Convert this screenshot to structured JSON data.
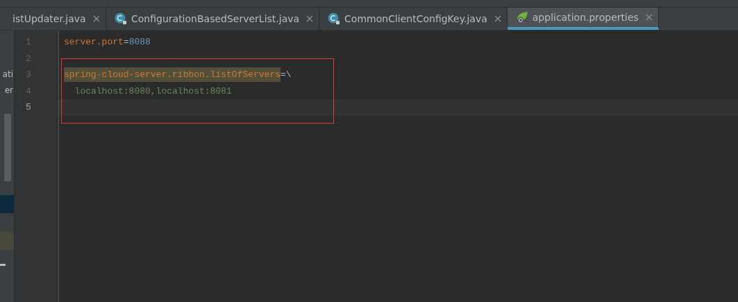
{
  "tabs": [
    {
      "label": "istUpdater.java",
      "kind": "plain",
      "selected": false
    },
    {
      "label": "ConfigurationBasedServerList.java",
      "kind": "class",
      "selected": false
    },
    {
      "label": "CommonClientConfigKey.java",
      "kind": "class",
      "selected": false
    },
    {
      "label": "application.properties",
      "kind": "spring",
      "selected": true
    }
  ],
  "side_panel": {
    "texts": [
      "ati",
      "er"
    ]
  },
  "editor": {
    "lines": [
      {
        "number": "1",
        "current": false,
        "tokens": [
          {
            "text": "server.port",
            "kind": "key",
            "highlighted": false
          },
          {
            "text": "=",
            "kind": "sep",
            "highlighted": false
          },
          {
            "text": "8088",
            "kind": "number",
            "highlighted": false
          }
        ]
      },
      {
        "number": "2",
        "current": false
      },
      {
        "number": "3",
        "current": false,
        "tokens": [
          {
            "text": "spring-cloud-server.ribbon.listOfServers",
            "kind": "key",
            "highlighted": true
          },
          {
            "text": "=\\",
            "kind": "sep",
            "highlighted": false
          }
        ]
      },
      {
        "number": "4",
        "current": false,
        "tokens": [
          {
            "text": "  localhost:8080,localhost:8081",
            "kind": "value",
            "highlighted": false
          }
        ]
      },
      {
        "number": "5",
        "current": true
      }
    ]
  }
}
